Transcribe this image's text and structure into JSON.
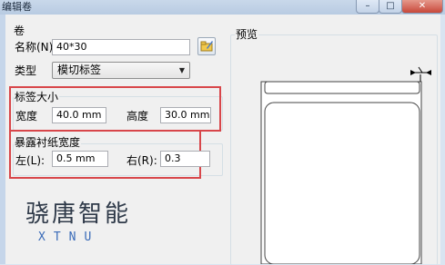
{
  "window": {
    "title": "编辑卷",
    "close_glyph": "✕",
    "min_glyph": "–",
    "max_glyph": "□"
  },
  "roll_group": {
    "title": "卷",
    "name_label": "名称(N):",
    "name_value": "40*30",
    "type_label": "类型",
    "type_value": "模切标签"
  },
  "label_size": {
    "title": "标签大小",
    "width_label": "宽度",
    "width_value": "40.0 mm",
    "height_label": "高度",
    "height_value": "30.0 mm"
  },
  "liner_width": {
    "title": "暴露衬纸宽度",
    "left_label": "左(L):",
    "left_value": "0.5 mm",
    "right_label": "右(R):",
    "right_value": "0.3"
  },
  "preview": {
    "title": "预览"
  },
  "logo": {
    "text": "骁唐智能",
    "sub": "XTNU"
  },
  "colors": {
    "highlight_box": "#d8464a",
    "logo_accent": "#3a6bb8"
  }
}
